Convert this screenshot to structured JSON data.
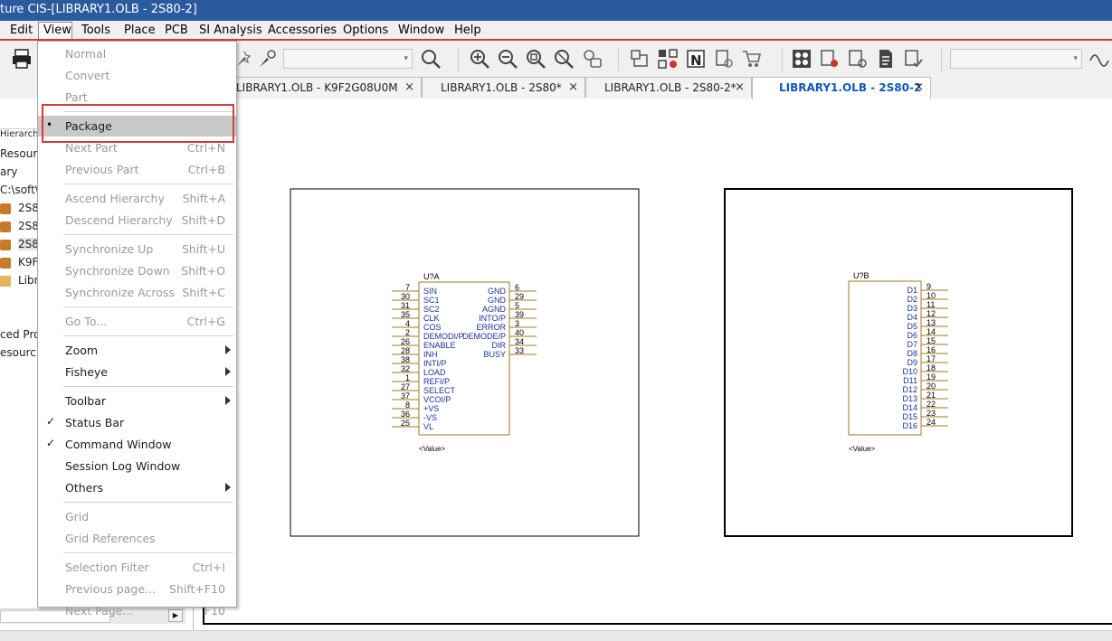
{
  "window": {
    "title": "ture CIS-[LIBRARY1.OLB - 2S80-2]"
  },
  "menubar": {
    "items": [
      "Edit",
      "View",
      "Tools",
      "Place",
      "PCB",
      "SI Analysis",
      "Accessories",
      "Options",
      "Window",
      "Help"
    ],
    "active": "View"
  },
  "toolbar": {
    "icons": [
      "print-icon",
      "probe-icon",
      "zoom-icon",
      "zoom-in-icon",
      "zoom-out-icon",
      "zoom-area-icon",
      "zoom-all-icon",
      "search-part-icon",
      "netlist-icon",
      "assign-icon",
      "n-icon",
      "annotate-icon",
      "cart-icon",
      "components-icon",
      "drc-icon",
      "bom-icon",
      "report-icon",
      "check-icon",
      "waveform-icon"
    ]
  },
  "tabs": [
    {
      "label": "LIBRARY1.OLB - K9F2G08U0M",
      "close": "×"
    },
    {
      "label": "LIBRARY1.OLB - 2S80*",
      "close": "×"
    },
    {
      "label": "LIBRARY1.OLB - 2S80-2*",
      "close": "×"
    },
    {
      "label": "LIBRARY1.OLB - 2S80-2",
      "close": "×",
      "active": true
    }
  ],
  "left_panel": {
    "lines": [
      "Hierarchy",
      "Resourc",
      "ary",
      "C:\\soft\\",
      "2S8",
      "2S8",
      "2S8",
      "K9F",
      "Libr",
      "ced Pro",
      "esourc"
    ]
  },
  "view_menu": [
    {
      "label": "Normal",
      "shortcut": "",
      "state": "disabled"
    },
    {
      "label": "Convert",
      "shortcut": "",
      "state": "disabled"
    },
    {
      "label": "Part",
      "shortcut": "",
      "state": "disabled"
    },
    {
      "label": "Package",
      "shortcut": "",
      "state": "selected",
      "mark": "•"
    },
    {
      "label": "Next Part",
      "shortcut": "Ctrl+N",
      "state": "disabled"
    },
    {
      "label": "Previous Part",
      "shortcut": "Ctrl+B",
      "state": "disabled"
    },
    {
      "label": "Ascend Hierarchy",
      "shortcut": "Shift+A",
      "state": "disabled"
    },
    {
      "label": "Descend Hierarchy",
      "shortcut": "Shift+D",
      "state": "disabled"
    },
    {
      "label": "Synchronize Up",
      "shortcut": "Shift+U",
      "state": "disabled"
    },
    {
      "label": "Synchronize Down",
      "shortcut": "Shift+O",
      "state": "disabled"
    },
    {
      "label": "Synchronize Across",
      "shortcut": "Shift+C",
      "state": "disabled"
    },
    {
      "label": "Go To...",
      "shortcut": "Ctrl+G",
      "state": "disabled"
    },
    {
      "label": "Zoom",
      "shortcut": "",
      "state": "enabled",
      "submenu": true
    },
    {
      "label": "Fisheye",
      "shortcut": "",
      "state": "enabled",
      "submenu": true
    },
    {
      "label": "Toolbar",
      "shortcut": "",
      "state": "enabled",
      "submenu": true
    },
    {
      "label": "Status Bar",
      "shortcut": "",
      "state": "enabled",
      "mark": "✓"
    },
    {
      "label": "Command Window",
      "shortcut": "",
      "state": "enabled",
      "mark": "✓"
    },
    {
      "label": "Session Log Window",
      "shortcut": "",
      "state": "enabled"
    },
    {
      "label": "Others",
      "shortcut": "",
      "state": "enabled",
      "submenu": true
    },
    {
      "label": "Grid",
      "shortcut": "",
      "state": "disabled"
    },
    {
      "label": "Grid References",
      "shortcut": "",
      "state": "disabled"
    },
    {
      "label": "Selection Filter",
      "shortcut": "Ctrl+I",
      "state": "disabled"
    },
    {
      "label": "Previous page...",
      "shortcut": "Shift+F10",
      "state": "disabled"
    },
    {
      "label": "Next Page...",
      "shortcut": "F10",
      "state": "disabled"
    }
  ],
  "part_a": {
    "ref": "U?A",
    "value": "<Value>",
    "left_pins": [
      {
        "num": "7",
        "name": "SIN"
      },
      {
        "num": "30",
        "name": "SC1"
      },
      {
        "num": "31",
        "name": "SC2"
      },
      {
        "num": "35",
        "name": "CLK"
      },
      {
        "num": "4",
        "name": "COS"
      },
      {
        "num": "2",
        "name": "DEMODI/P"
      },
      {
        "num": "26",
        "name": "ENABLE"
      },
      {
        "num": "28",
        "name": "INH"
      },
      {
        "num": "38",
        "name": "INTI/P"
      },
      {
        "num": "32",
        "name": "LOAD"
      },
      {
        "num": "1",
        "name": "REFI/P"
      },
      {
        "num": "27",
        "name": "SELECT"
      },
      {
        "num": "37",
        "name": "VCOI/P"
      },
      {
        "num": "8",
        "name": "+VS"
      },
      {
        "num": "36",
        "name": "-VS"
      },
      {
        "num": "25",
        "name": "VL"
      }
    ],
    "right_pins": [
      {
        "num": "6",
        "name": "GND"
      },
      {
        "num": "29",
        "name": "GND"
      },
      {
        "num": "5",
        "name": "AGND"
      },
      {
        "num": "39",
        "name": "INTO/P"
      },
      {
        "num": "3",
        "name": "ERROR"
      },
      {
        "num": "40",
        "name": "DEMODE/P"
      },
      {
        "num": "34",
        "name": "DIR"
      },
      {
        "num": "33",
        "name": "BUSY"
      }
    ]
  },
  "part_b": {
    "ref": "U?B",
    "value": "<Value>",
    "right_pins": [
      {
        "num": "9",
        "name": "D1"
      },
      {
        "num": "10",
        "name": "D2"
      },
      {
        "num": "11",
        "name": "D3"
      },
      {
        "num": "12",
        "name": "D4"
      },
      {
        "num": "13",
        "name": "D5"
      },
      {
        "num": "14",
        "name": "D6"
      },
      {
        "num": "15",
        "name": "D7"
      },
      {
        "num": "16",
        "name": "D8"
      },
      {
        "num": "17",
        "name": "D9"
      },
      {
        "num": "18",
        "name": "D10"
      },
      {
        "num": "19",
        "name": "D11"
      },
      {
        "num": "20",
        "name": "D12"
      },
      {
        "num": "21",
        "name": "D13"
      },
      {
        "num": "22",
        "name": "D14"
      },
      {
        "num": "23",
        "name": "D15"
      },
      {
        "num": "24",
        "name": "D16"
      }
    ]
  },
  "colors": {
    "titlebar": "#2b5a9e",
    "highlight_red": "#d9383a",
    "part_body": "#a07820",
    "pin_text": "#1b2f9e",
    "active_tab_text": "#1456b8"
  }
}
